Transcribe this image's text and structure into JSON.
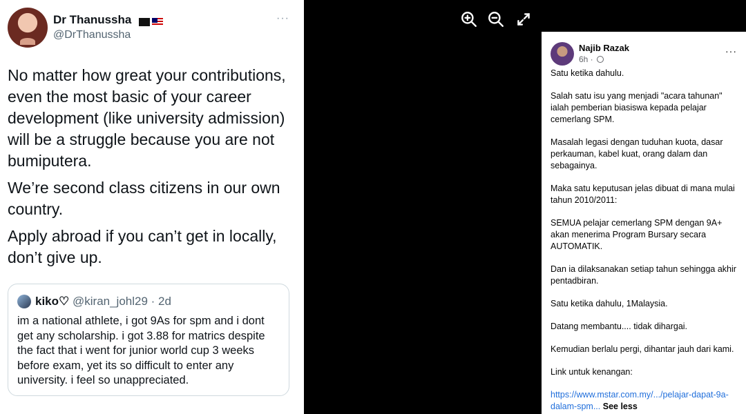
{
  "tweet": {
    "name": "Dr Thanussha",
    "handle": "@DrThanussha",
    "more": "···",
    "paragraphs": [
      "No matter how great your contributions, even the most basic of your career development (like university admission) will be a struggle because you are not bumiputera.",
      "We’re second class citizens in our own country.",
      "Apply abroad if you can’t get in locally, don’t give up."
    ],
    "quote": {
      "name": "kiko♡",
      "handle": "@kiran_johl29 · 2d",
      "text": "im a national athlete, i got 9As for spm and i dont get any scholarship. i got 3.88 for matrics despite the fact that i went for junior world cup 3 weeks before exam, yet its so difficult to enter any university. i feel so unappreciated."
    }
  },
  "viewer": {
    "buttons": [
      "zoom-in-icon",
      "zoom-out-icon",
      "fullscreen-icon"
    ]
  },
  "facebook": {
    "name": "Najib Razak",
    "time": "6h ·",
    "more": "···",
    "paragraphs": [
      "Satu ketika dahulu.",
      "Salah satu isu yang menjadi \"acara tahunan\" ialah pemberian biasiswa kepada pelajar cemerlang SPM.",
      "Masalah legasi dengan tuduhan kuota, dasar perkauman, kabel kuat, orang dalam dan sebagainya.",
      "Maka satu keputusan jelas dibuat di mana mulai tahun 2010/2011:",
      "SEMUA pelajar cemerlang SPM dengan 9A+ akan menerima Program Bursary secara AUTOMATIK.",
      "Dan ia dilaksanakan setiap tahun sehingga akhir pentadbiran.",
      "Satu ketika dahulu, 1Malaysia.",
      "Datang membantu.... tidak dihargai.",
      "Kemudian berlalu pergi, dihantar jauh dari kami.",
      "Link untuk kenangan:"
    ],
    "link": "https://www.mstar.com.my/.../pelajar-dapat-9a-dalam-spm...",
    "see_less": "See less"
  }
}
